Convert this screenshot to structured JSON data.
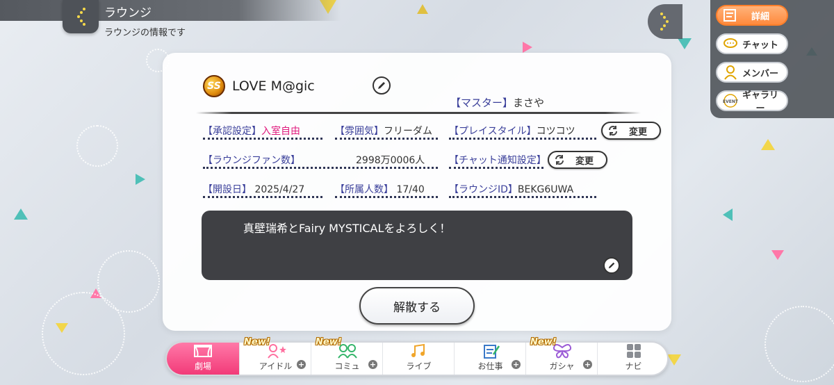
{
  "header": {
    "title": "ラウンジ",
    "subtitle": "ラウンジの情報です"
  },
  "side_menu": {
    "items": [
      {
        "label": "詳細",
        "icon": "detail-icon",
        "active": true
      },
      {
        "label": "チャット",
        "icon": "chat-icon",
        "active": false
      },
      {
        "label": "メンバー",
        "icon": "member-icon",
        "active": false
      },
      {
        "label": "ギャラリー",
        "icon": "event-gallery-icon",
        "active": false,
        "icon_text": "EVENT"
      }
    ]
  },
  "lounge": {
    "rank_badge": "SS",
    "name": "LOVE M@gic",
    "master_key": "【マスター】",
    "master_value": "まさや",
    "approval_key": "【承認設定】",
    "approval_value": "入室自由",
    "mood_key": "【雰囲気】",
    "mood_value": "フリーダム",
    "playstyle_key": "【プレイスタイル】",
    "playstyle_value": "コツコツ",
    "fans_key": "【ラウンジファン数】",
    "fans_value": "2998万0006人",
    "chat_notify_key": "【チャット通知設定】",
    "opened_key": "【開設日】",
    "opened_value": "2025/4/27",
    "members_key": "【所属人数】",
    "members_value": "17/40",
    "id_key": "【ラウンジID】",
    "id_value": "BEKG6UWA",
    "comment": "真壁瑞希とFairy MYSTICALをよろしく！",
    "change_label": "変更",
    "disband_label": "解散する"
  },
  "nav": {
    "new_label": "New!",
    "items": [
      {
        "label": "劇場",
        "active": true,
        "new": false,
        "plus": false
      },
      {
        "label": "アイドル",
        "active": false,
        "new": true,
        "plus": true
      },
      {
        "label": "コミュ",
        "active": false,
        "new": true,
        "plus": true
      },
      {
        "label": "ライブ",
        "active": false,
        "new": false,
        "plus": false
      },
      {
        "label": "お仕事",
        "active": false,
        "new": false,
        "plus": true
      },
      {
        "label": "ガシャ",
        "active": false,
        "new": true,
        "plus": true
      },
      {
        "label": "ナビ",
        "active": false,
        "new": false,
        "plus": false
      }
    ]
  },
  "colors": {
    "accent_pink": "#f23a78",
    "accent_orange": "#ff8a3d",
    "key_blue": "#3a3f9a",
    "highlight_pink": "#e0197d"
  }
}
